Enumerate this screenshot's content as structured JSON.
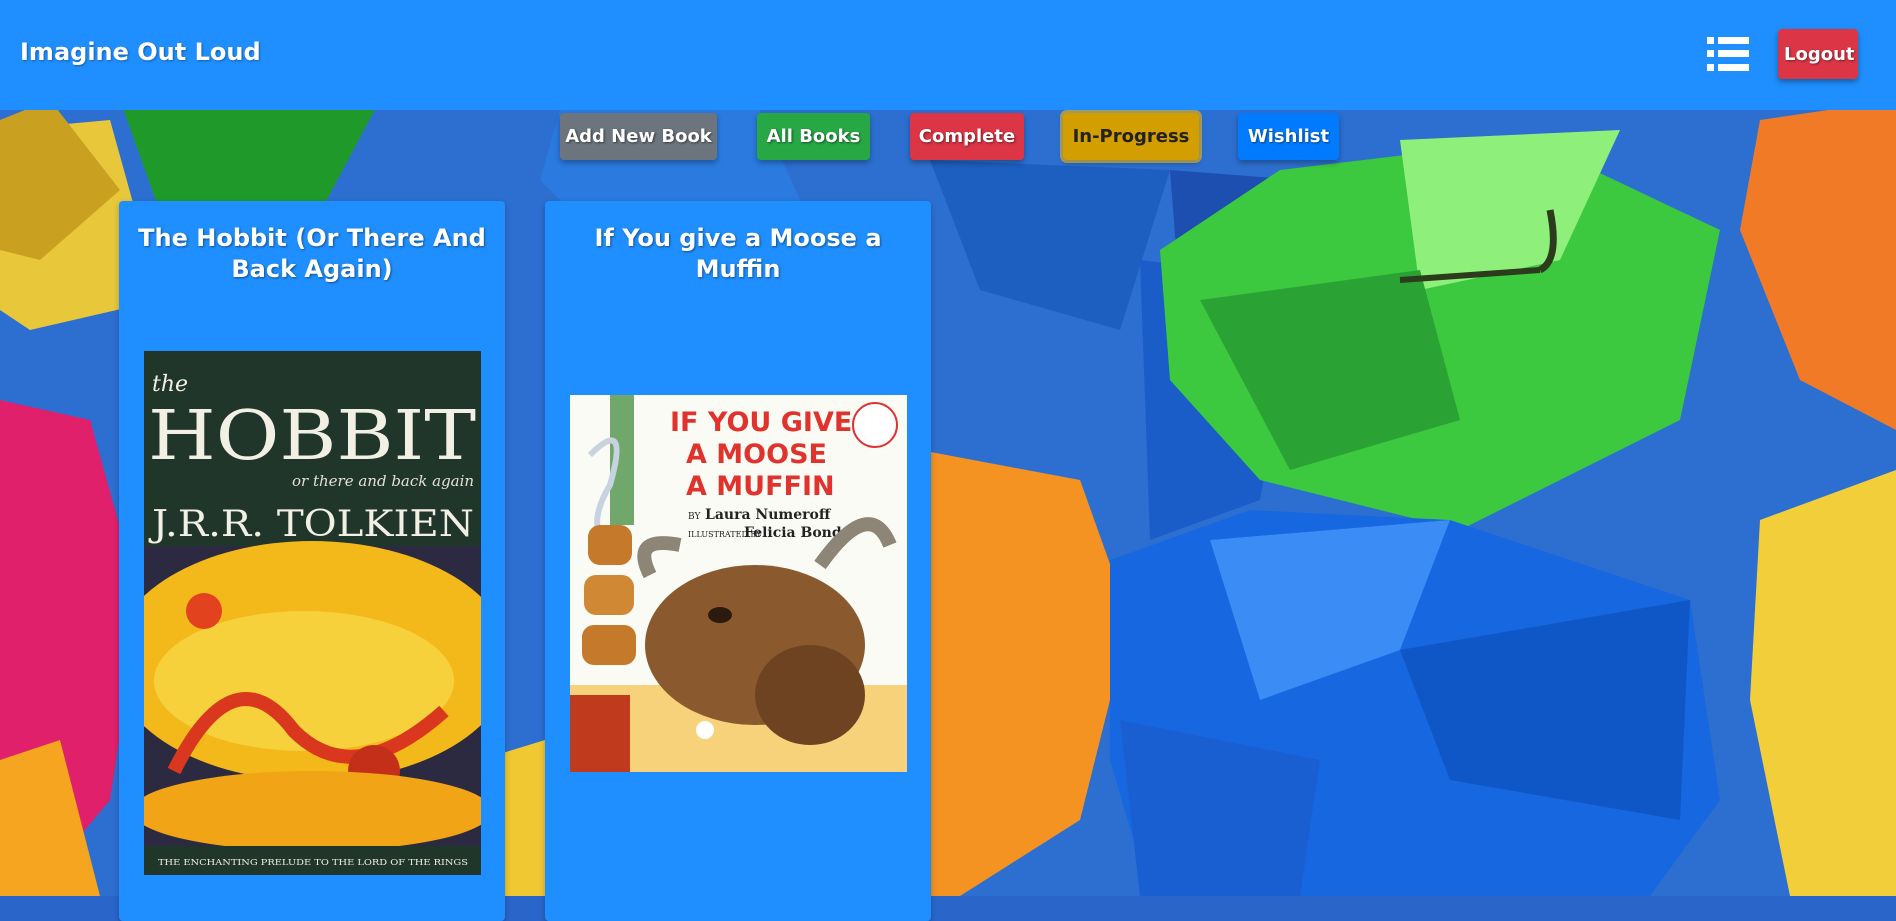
{
  "navbar": {
    "brand": "Imagine Out Loud",
    "menu_icon": "hamburger-list-icon",
    "logout_label": "Logout"
  },
  "filters": {
    "add_new_book": "Add New Book",
    "all_books": "All Books",
    "complete": "Complete",
    "in_progress": "In-Progress",
    "wishlist": "Wishlist"
  },
  "books": [
    {
      "title": "The Hobbit (Or There And Back Again)",
      "cover": {
        "word_the": "the",
        "title": "HOBBIT",
        "subtitle": "or there and back again",
        "author": "J.R.R. TOLKIEN",
        "tagline": "THE ENCHANTING PRELUDE TO THE LORD OF THE RINGS"
      }
    },
    {
      "title": "If You give a Moose a Muffin",
      "cover": {
        "line1": "IF YOU GIVE",
        "line2": "A MOOSE",
        "line3": "A MUFFIN",
        "by": "BY",
        "author": "Laura Numeroff",
        "illustrated_by": "ILLUSTRATED BY",
        "illustrator": "Felicia Bond"
      }
    }
  ],
  "colors": {
    "navbar": "#1f8fff",
    "card": "#1f8fff",
    "logout": "#dc3545",
    "add": "#6c757d",
    "all": "#28a745",
    "complete": "#dc3545",
    "in_progress": "#d39e00",
    "wishlist": "#007bff"
  }
}
